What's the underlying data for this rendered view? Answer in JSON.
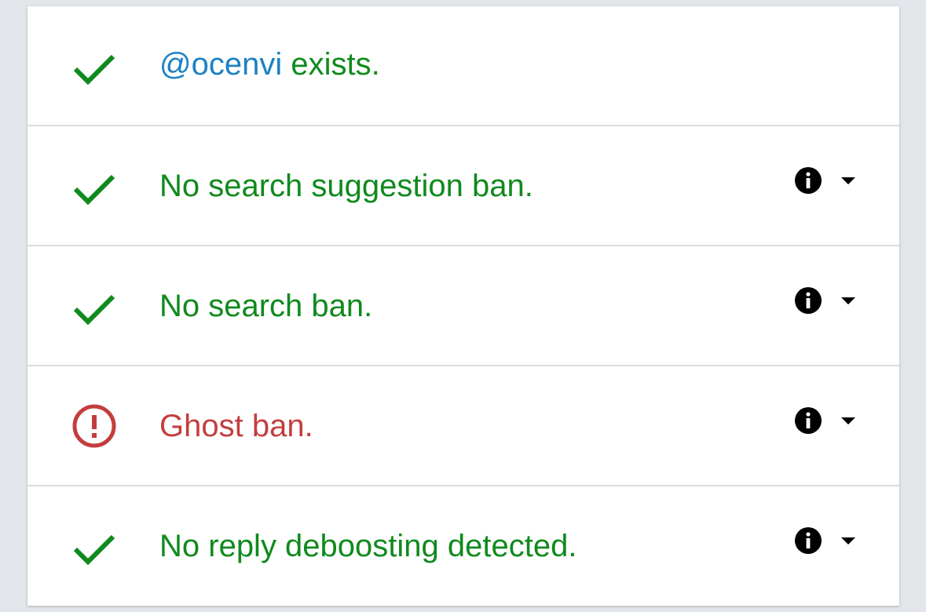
{
  "colors": {
    "ok": "#0f8a1d",
    "fail": "#c43d3d",
    "handle": "#1d80c3",
    "icon": "#000000"
  },
  "checks": [
    {
      "status": "ok",
      "icon": "check-icon",
      "handle": "@ocenvi",
      "label": " exists.",
      "has_details": false
    },
    {
      "status": "ok",
      "icon": "check-icon",
      "label": "No search suggestion ban.",
      "has_details": true
    },
    {
      "status": "ok",
      "icon": "check-icon",
      "label": "No search ban.",
      "has_details": true
    },
    {
      "status": "fail",
      "icon": "alert-circle-icon",
      "label": "Ghost ban.",
      "has_details": true
    },
    {
      "status": "ok",
      "icon": "check-icon",
      "label": "No reply deboosting detected.",
      "has_details": true
    }
  ]
}
